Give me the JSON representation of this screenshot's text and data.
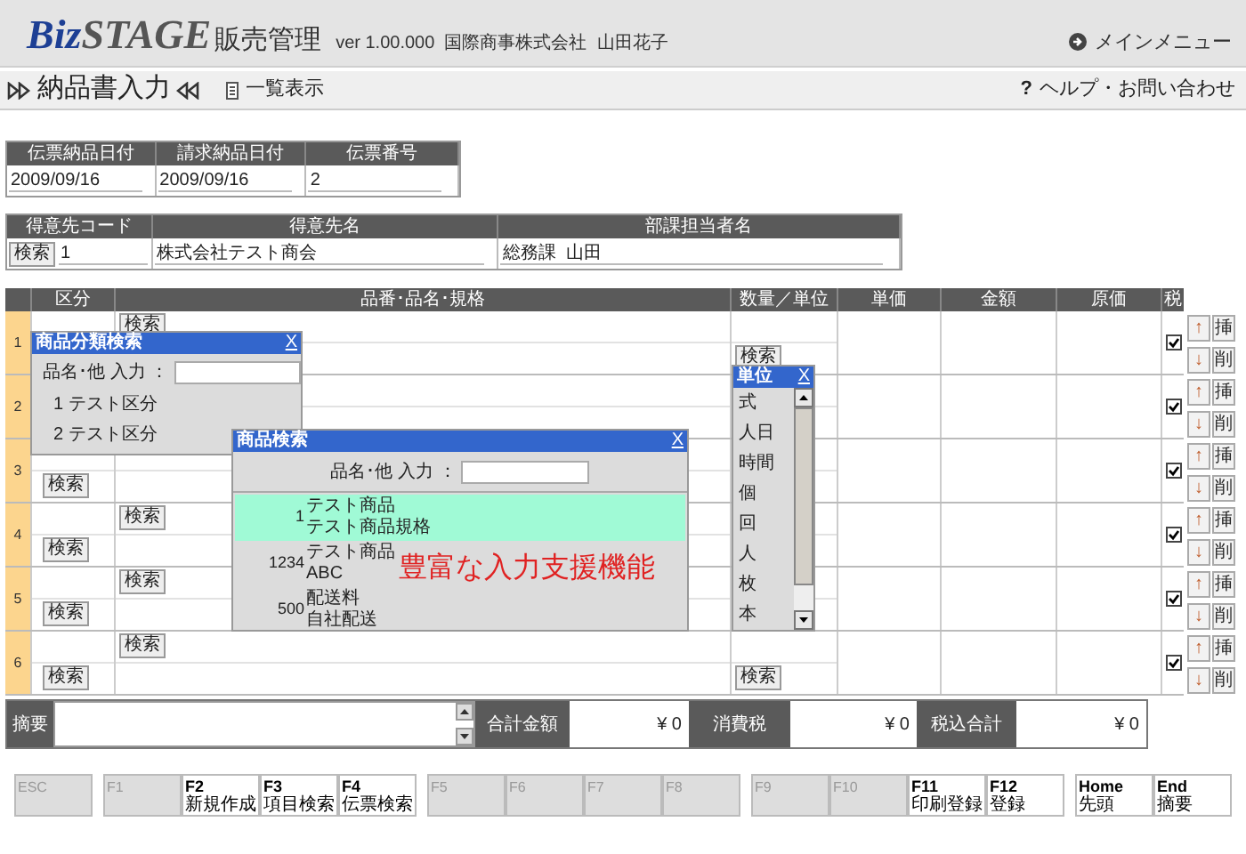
{
  "header": {
    "logo_part1": "Biz",
    "logo_part2": "STAGE",
    "app_name": "販売管理",
    "info": "ver 1.00.000  国際商事株式会社  山田花子",
    "main_menu": "メインメニュー"
  },
  "page": {
    "title": "納品書入力",
    "list_view": "一覧表示",
    "help_mark": "?",
    "help": "ヘルプ・お問い合わせ"
  },
  "slip": {
    "columns": [
      "伝票納品日付",
      "請求納品日付",
      "伝票番号"
    ],
    "values": [
      "2009/09/16",
      "2009/09/16",
      "2"
    ]
  },
  "customer": {
    "columns": [
      "得意先コード",
      "得意先名",
      "部課担当者名"
    ],
    "search_button": "検索",
    "code": "1",
    "name": "株式会社テスト商会",
    "staff": "総務課  山田"
  },
  "lines": {
    "columns": [
      "区分",
      "品番･品名･規格",
      "数量／単位",
      "単価",
      "金額",
      "原価",
      "税"
    ],
    "rows": [
      {
        "number": "1",
        "buttons": [
          {
            "kind": "item",
            "label": "検索"
          },
          {
            "kind": "quantity",
            "label": "検索"
          }
        ],
        "tax": true,
        "move_up": "↑",
        "insert": "挿",
        "move_down": "↓",
        "delete": "削"
      },
      {
        "number": "2",
        "tax": true,
        "move_up": "↑",
        "insert": "挿",
        "move_down": "↓",
        "delete": "削"
      },
      {
        "number": "3",
        "buttons": [
          {
            "kind": "category",
            "label": "検索"
          }
        ],
        "tax": true,
        "move_up": "↑",
        "insert": "挿",
        "move_down": "↓",
        "delete": "削"
      },
      {
        "number": "4",
        "buttons": [
          {
            "kind": "item",
            "label": "検索"
          },
          {
            "kind": "category",
            "label": "検索"
          }
        ],
        "tax": true,
        "move_up": "↑",
        "insert": "挿",
        "move_down": "↓",
        "delete": "削"
      },
      {
        "number": "5",
        "buttons": [
          {
            "kind": "item",
            "label": "検索"
          },
          {
            "kind": "category",
            "label": "検索"
          }
        ],
        "tax": true,
        "move_up": "↑",
        "insert": "挿",
        "move_down": "↓",
        "delete": "削"
      },
      {
        "number": "6",
        "buttons": [
          {
            "kind": "item",
            "label": "検索"
          },
          {
            "kind": "category",
            "label": "検索"
          },
          {
            "kind": "quantity",
            "label": "検索"
          }
        ],
        "tax": true,
        "move_up": "↑",
        "insert": "挿",
        "move_down": "↓",
        "delete": "削"
      }
    ]
  },
  "category_search": {
    "title": "商品分類検索",
    "close": "X",
    "filter_label": "品名･他 入力 ：",
    "items": [
      "1 テスト区分",
      "2 テスト区分"
    ]
  },
  "product_search": {
    "title": "商品検索",
    "close": "X",
    "filter_label": "品名･他 入力 ：",
    "results": [
      {
        "code": "1",
        "name": "テスト商品",
        "spec": "テスト商品規格",
        "selected": true
      },
      {
        "code": "1234",
        "name": "テスト商品",
        "spec": "ABC",
        "selected": false
      },
      {
        "code": "500",
        "name": "配送料",
        "spec": "自社配送",
        "selected": false
      }
    ]
  },
  "caption": "豊富な入力支援機能",
  "unit_picker": {
    "title": "単位",
    "close": "X",
    "items": [
      "式",
      "人日",
      "時間",
      "個",
      "回",
      "人",
      "枚",
      "本"
    ]
  },
  "summary": {
    "memo_label": "摘要",
    "totals": [
      {
        "label": "合計金額",
        "value": "¥ 0"
      },
      {
        "label": "消費税",
        "value": "¥ 0"
      },
      {
        "label": "税込合計",
        "value": "¥ 0"
      }
    ]
  },
  "function_keys": [
    [
      {
        "key": "ESC",
        "disabled": true
      }
    ],
    [
      {
        "key": "F1",
        "disabled": true
      },
      {
        "key": "F2",
        "action": "新規作成",
        "disabled": false
      },
      {
        "key": "F3",
        "action": "項目検索",
        "disabled": false
      },
      {
        "key": "F4",
        "action": "伝票検索",
        "disabled": false
      }
    ],
    [
      {
        "key": "F5",
        "disabled": true
      },
      {
        "key": "F6",
        "disabled": true
      },
      {
        "key": "F7",
        "disabled": true
      },
      {
        "key": "F8",
        "disabled": true
      }
    ],
    [
      {
        "key": "F9",
        "disabled": true
      },
      {
        "key": "F10",
        "disabled": true
      },
      {
        "key": "F11",
        "action": "印刷登録",
        "disabled": false
      },
      {
        "key": "F12",
        "action": "登録",
        "disabled": false
      }
    ],
    [
      {
        "key": "Home",
        "action": "先頭",
        "disabled": false
      },
      {
        "key": "End",
        "action": "摘要",
        "disabled": false
      }
    ]
  ]
}
